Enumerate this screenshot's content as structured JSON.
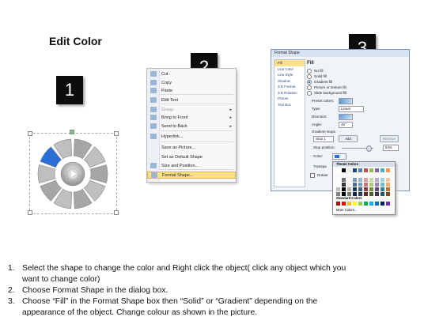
{
  "title": "Edit Color",
  "steps": [
    "1",
    "2",
    "3"
  ],
  "context_menu": {
    "items": [
      {
        "label": "Cut",
        "icon": "scissors-icon",
        "disabled": false,
        "arrow": false
      },
      {
        "label": "Copy",
        "icon": "copy-icon",
        "disabled": false,
        "arrow": false
      },
      {
        "label": "Paste",
        "icon": "paste-icon",
        "disabled": false,
        "arrow": false
      },
      {
        "label": "Edit Text",
        "icon": "edit-text-icon",
        "disabled": false,
        "arrow": false
      },
      {
        "label": "Group",
        "icon": "group-icon",
        "disabled": true,
        "arrow": true
      },
      {
        "label": "Bring to Front",
        "icon": "bring-front-icon",
        "disabled": false,
        "arrow": true
      },
      {
        "label": "Send to Back",
        "icon": "send-back-icon",
        "disabled": false,
        "arrow": true
      },
      {
        "label": "Hyperlink...",
        "icon": "hyperlink-icon",
        "disabled": false,
        "arrow": false
      },
      {
        "label": "Save as Picture...",
        "icon": "",
        "disabled": false,
        "arrow": false
      },
      {
        "label": "Set as Default Shape",
        "icon": "",
        "disabled": false,
        "arrow": false
      },
      {
        "label": "Size and Position...",
        "icon": "size-icon",
        "disabled": false,
        "arrow": false
      },
      {
        "label": "Format Shape...",
        "icon": "format-shape-icon",
        "disabled": false,
        "arrow": false,
        "highlighted": true
      }
    ]
  },
  "format_dialog": {
    "title": "Format Shape",
    "sidebar": [
      "Fill",
      "Line Color",
      "Line Style",
      "Shadow",
      "3-D Format",
      "3-D Rotation",
      "Picture",
      "Text Box"
    ],
    "heading": "Fill",
    "fill_options": [
      "No fill",
      "Solid fill",
      "Gradient fill",
      "Picture or texture fill",
      "Slide background fill"
    ],
    "selected_fill": "Gradient fill",
    "preset_label": "Preset colors:",
    "type_label": "Type:",
    "type_value": "Linear",
    "direction_label": "Direction:",
    "angle_label": "Angle:",
    "angle_value": "45°",
    "stops_label": "Gradient stops",
    "stop_value": "Stop 1",
    "add_label": "Add",
    "remove_label": "Remove",
    "stop_position_label": "Stop position:",
    "stop_position_value": "84%",
    "color_label": "Color:",
    "transparency_label": "Transpa",
    "rotate_label": "Rotate"
  },
  "palette": {
    "theme_label": "Theme Colors",
    "standard_label": "Standard Colors",
    "more_label": "More Colors...",
    "theme_top": [
      "#ffffff",
      "#000000",
      "#eeece1",
      "#1f497d",
      "#4f81bd",
      "#c0504d",
      "#9bbb59",
      "#8064a2",
      "#4bacc6",
      "#f79646"
    ],
    "standard": [
      "#c00000",
      "#ff0000",
      "#ffc000",
      "#ffff00",
      "#92d050",
      "#00b050",
      "#00b0f0",
      "#0070c0",
      "#002060",
      "#7030a0"
    ]
  },
  "instructions": [
    {
      "num": "1.",
      "lines": [
        "Select the shape to change the color and Right click the object( click any object which you",
        "want to change color)"
      ]
    },
    {
      "num": "2.",
      "lines": [
        "Choose Format Shape in the dialog box."
      ]
    },
    {
      "num": "3.",
      "lines": [
        "Choose “Fill” in the Format Shape box then “Solid” or “Gradient” depending on the",
        "appearance of the object. Change colour as shown in the picture."
      ]
    }
  ],
  "colors": {
    "accent_segment": "#2a6fd6",
    "menu_highlight": "#fbe08c"
  }
}
